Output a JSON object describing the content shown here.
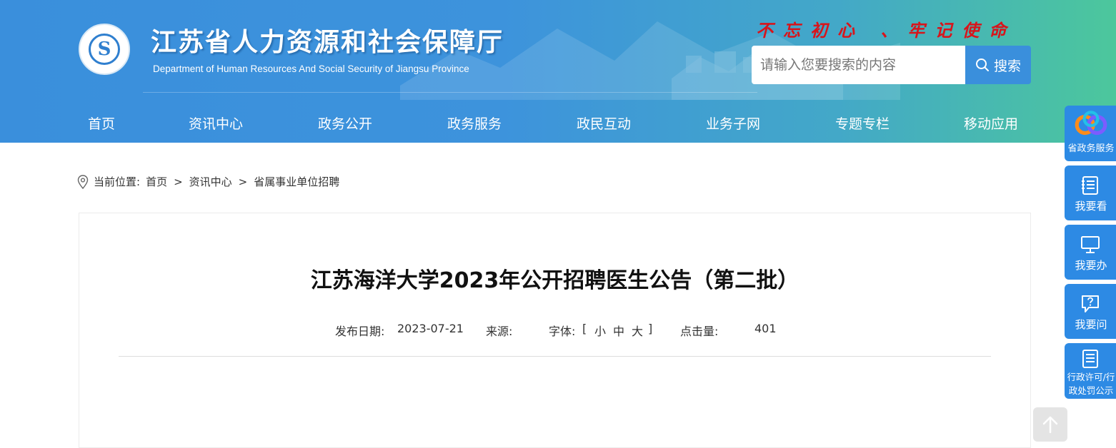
{
  "header": {
    "title": "江苏省人力资源和社会保障厅",
    "subtitle": "Department of Human Resources And Social Security of Jiangsu Province",
    "slogan": "不忘初心 、牢记使命",
    "logo_icon": "department-seal-logo",
    "colors": {
      "gradient_start": "#3a8fdc",
      "gradient_end": "#4cc79c",
      "slogan": "#d8141b"
    }
  },
  "search": {
    "placeholder": "请输入您要搜索的内容",
    "value": "",
    "button_label": "搜索",
    "icon": "search-icon"
  },
  "nav": {
    "items": [
      "首页",
      "资讯中心",
      "政务公开",
      "政务服务",
      "政民互动",
      "业务子网",
      "专题专栏",
      "移动应用"
    ]
  },
  "breadcrumb": {
    "label": "当前位置:",
    "items": [
      "首页",
      "资讯中心",
      "省属事业单位招聘"
    ],
    "separator": ">",
    "icon": "location-pin-icon"
  },
  "article": {
    "title": "江苏海洋大学2023年公开招聘医生公告（第二批）",
    "date_label": "发布日期:",
    "date": "2023-07-21",
    "source_label": "来源:",
    "source": "",
    "font_label": "字体:",
    "font_open": "[",
    "font_options": [
      "小",
      "中",
      "大"
    ],
    "font_close": "]",
    "hits_label": "点击量:",
    "hits": "401"
  },
  "sidebar": {
    "items": [
      {
        "label": "省政务服务",
        "icon": "government-service-logo-icon"
      },
      {
        "label": "我要看",
        "icon": "document-list-icon"
      },
      {
        "label": "我要办",
        "icon": "monitor-icon"
      },
      {
        "label": "我要问",
        "icon": "question-bubble-icon"
      },
      {
        "label": "行政许可/行政处罚公示",
        "icon": "notice-list-icon"
      }
    ]
  },
  "back_to_top": {
    "icon": "arrow-up-icon"
  }
}
